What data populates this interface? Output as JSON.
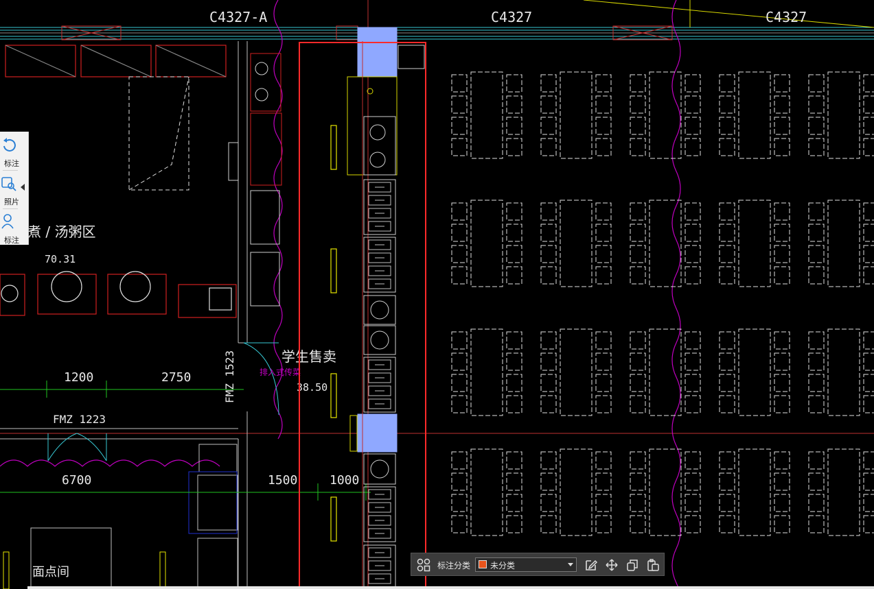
{
  "drawing": {
    "window_labels": [
      "C4327-A",
      "C4327",
      "C4327"
    ],
    "room_labels": {
      "soup_area": "煮  / 汤粥区",
      "soup_area_value": "70.31",
      "student_sales": "学生售卖",
      "student_sales_value": "38.50",
      "pastry_room": "面点间"
    },
    "dimensions": [
      "1200",
      "2750",
      "6700",
      "1500",
      "1000"
    ],
    "door_labels": [
      "FMZ 1523",
      "FMZ 1223"
    ],
    "magenta_note": "排入式传菜"
  },
  "side_panel": {
    "items": [
      {
        "icon": "rotate-annotation-icon",
        "label": "标注"
      },
      {
        "icon": "photo-search-icon",
        "label": "照片"
      },
      {
        "icon": "person-annotation-icon",
        "label": "标注"
      }
    ]
  },
  "toolbar": {
    "label": "标注分类",
    "select_value": "未分类",
    "swatch_color": "#e8541c",
    "icons": [
      "group-icon",
      "edit-icon",
      "move-icon",
      "copy-icon",
      "paste-icon"
    ]
  },
  "colors": {
    "selection": "#ff2a2a",
    "blue_fill": "#8fa8ff",
    "cyan": "#37c8d4",
    "magenta": "#c000c0",
    "green": "#21c321",
    "yellow": "#e6e600"
  }
}
